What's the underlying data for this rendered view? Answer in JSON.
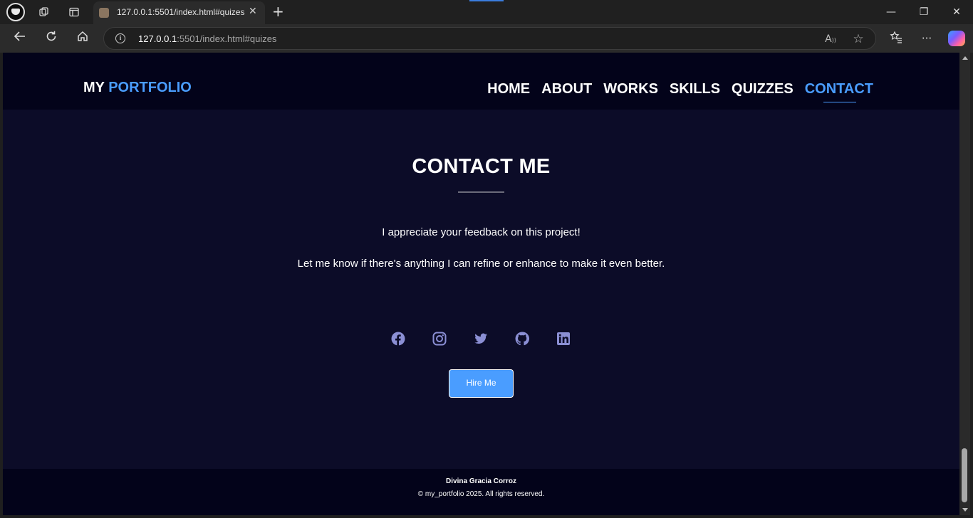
{
  "browser": {
    "tab_title": "127.0.0.1:5501/index.html#quizes",
    "url_host": "127.0.0.1",
    "url_rest": ":5501/index.html#quizes",
    "icons": {
      "workspaces": "workspaces-icon",
      "tab_actions": "tab-actions-icon",
      "new_tab": "plus-icon",
      "back": "back-arrow-icon",
      "refresh": "refresh-icon",
      "home": "home-icon",
      "site_info": "info-icon",
      "read_aloud": "read-aloud-icon",
      "favorite": "star-icon",
      "favorites": "favorites-icon",
      "more": "more-icon",
      "copilot": "copilot-icon"
    }
  },
  "site": {
    "logo_prefix": "MY",
    "logo_accent": "PORTFOLIO",
    "nav": [
      {
        "label": "HOME"
      },
      {
        "label": "ABOUT"
      },
      {
        "label": "WORKS"
      },
      {
        "label": "SKILLS"
      },
      {
        "label": "QUIZZES"
      },
      {
        "label": "CONTACT",
        "active": true
      }
    ],
    "accent_color": "#4a9dff",
    "background_color": "#0c0c28"
  },
  "contact": {
    "title": "CONTACT ME",
    "line1": "I appreciate your feedback on this project!",
    "line2": "Let me know if there's anything I can refine or enhance to make it even better.",
    "socials": [
      "facebook-icon",
      "instagram-icon",
      "twitter-icon",
      "github-icon",
      "linkedin-icon"
    ],
    "social_color": "#8b8fd4",
    "hire_label": "Hire Me"
  },
  "footer": {
    "name": "Divina Gracia Corroz",
    "copyright": "© my_portfolio 2025. All rights reserved."
  }
}
